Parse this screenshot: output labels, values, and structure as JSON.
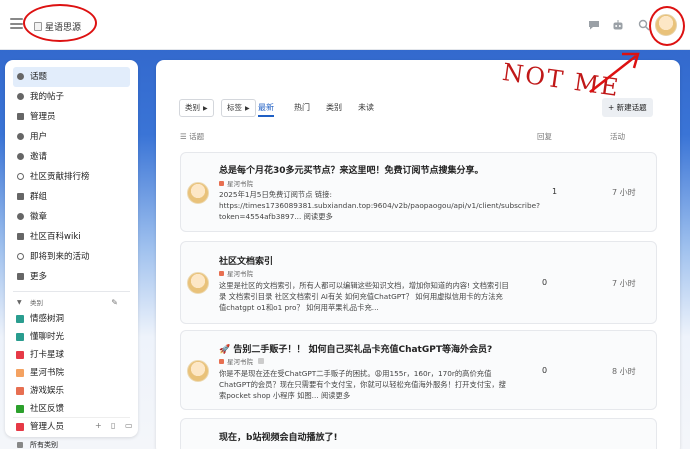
{
  "header": {
    "logo_alt": "星语思源",
    "menu_icon": "hamburger-icon",
    "icons": [
      "chat-icon",
      "robot-icon",
      "search-icon"
    ]
  },
  "annotations": {
    "not_me": "NOT ME",
    "color": "#d11111"
  },
  "sidebar": {
    "items": [
      {
        "label": "话题",
        "icon": "topics-icon"
      },
      {
        "label": "我的帖子",
        "icon": "user-icon"
      },
      {
        "label": "管理员",
        "icon": "wrench-icon"
      },
      {
        "label": "用户",
        "icon": "users-icon"
      },
      {
        "label": "邀请",
        "icon": "invite-icon"
      },
      {
        "label": "社区贡献排行榜",
        "icon": "link-icon"
      },
      {
        "label": "群组",
        "icon": "group-icon"
      },
      {
        "label": "徽章",
        "icon": "badge-icon"
      },
      {
        "label": "社区百科wiki",
        "icon": "doc-icon"
      },
      {
        "label": "即将到来的活动",
        "icon": "link-icon"
      },
      {
        "label": "更多",
        "icon": "more-icon"
      }
    ],
    "categories_header": "类别",
    "categories": [
      {
        "label": "情感树洞",
        "color": "#2a9d8f"
      },
      {
        "label": "懂聊时光",
        "color": "#2a9d8f"
      },
      {
        "label": "打卡星球",
        "color": "#e63946"
      },
      {
        "label": "星河书院",
        "color": "#f4a261"
      },
      {
        "label": "游戏娱乐",
        "color": "#e76f51"
      },
      {
        "label": "社区反馈",
        "color": "#2ca02c"
      },
      {
        "label": "管理人员",
        "color": "#e63946"
      }
    ],
    "all_categories": "所有类别"
  },
  "main": {
    "filters": {
      "category": "类别",
      "tags": "标签"
    },
    "tabs": [
      "最新",
      "热门",
      "类别",
      "未读"
    ],
    "active_tab": "最新",
    "new_topic": "+ 新建话题",
    "columns": {
      "topic": "话题",
      "replies": "回复",
      "activity": "活动"
    },
    "topics": [
      {
        "title": "总是每个月花30多元买节点？来这里吧！免费订阅节点搜集分享。",
        "category": "星河书院",
        "excerpt": "2025年1月5日免费订阅节点 链接: https://times1736089381.subxiandan.top:9604/v2b/paopaogou/api/v1/client/subscribe?token=4554afb3897... 阅读更多",
        "replies": "1",
        "activity": "7 小时"
      },
      {
        "title": "社区文档索引",
        "category": "星河书院",
        "excerpt": "这里是社区的文档索引，所有人都可以编辑这些知识文档，增加你知道的内容! 文档索引目录 文档索引目录 社区文档索引 AI有关 如何充值ChatGPT？ 如何用虚拟信用卡的方法充值chatgpt o1和o1 pro？ 如何用苹果礼品卡充...",
        "replies": "0",
        "activity": "7 小时"
      },
      {
        "title": "🚀 告别二手贩子！！ 如何自己买礼品卡充值ChatGPT等海外会员?",
        "category": "星河书院",
        "excerpt": "你是不是现在还在受ChatGPT二手贩子的困扰。😩用155r，160r，170r的高价充值ChatGPT的会员？现在只需要有个支付宝，你就可以轻松充值海外服务！打开支付宝，搜索pocket shop 小程序 如图... 阅读更多",
        "replies": "0",
        "activity": "8 小时"
      },
      {
        "title": "现在，b站视频会自动播放了!",
        "category": "",
        "excerpt": "",
        "replies": "",
        "activity": ""
      }
    ]
  }
}
